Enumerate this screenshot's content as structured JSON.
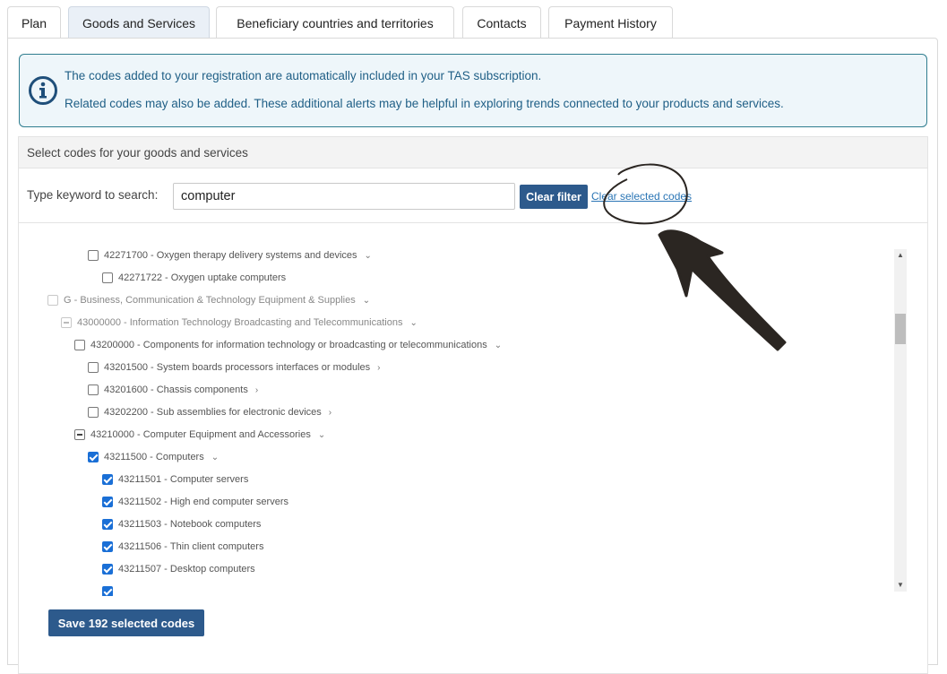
{
  "tabs": [
    {
      "label": "Plan"
    },
    {
      "label": "Goods and Services"
    },
    {
      "label": "Beneficiary countries and territories"
    },
    {
      "label": "Contacts"
    },
    {
      "label": "Payment History"
    }
  ],
  "info": {
    "line1": "The codes added to your registration are automatically included in your TAS subscription.",
    "line2": "Related codes may also be added. These additional alerts may be helpful in exploring trends connected to your products and services."
  },
  "codes": {
    "header": "Select codes for your goods and services",
    "search_label": "Type keyword to search:",
    "search_value": "computer",
    "clear_filter": "Clear filter",
    "clear_selected": "Clear selected codes",
    "save_label": "Save 192 selected codes"
  },
  "tree": [
    {
      "code": "42271700 -",
      "name": "Oxygen therapy delivery systems and devices",
      "state": "unchecked",
      "toggle": "expanded"
    },
    {
      "code": "42271722 -",
      "name": "Oxygen uptake computers",
      "state": "unchecked",
      "toggle": ""
    },
    {
      "code": "G -",
      "name": "Business, Communication & Technology Equipment & Supplies",
      "state": "disabled",
      "toggle": "expanded"
    },
    {
      "code": "43000000 -",
      "name": "Information Technology Broadcasting and Telecommunications",
      "state": "partial-disabled",
      "toggle": "expanded"
    },
    {
      "code": "43200000 -",
      "name": "Components for information technology or broadcasting or telecommunications",
      "state": "unchecked",
      "toggle": "expanded"
    },
    {
      "code": "43201500 -",
      "name": "System boards processors interfaces or modules",
      "state": "unchecked",
      "toggle": "collapsed"
    },
    {
      "code": "43201600 -",
      "name": "Chassis components",
      "state": "unchecked",
      "toggle": "collapsed"
    },
    {
      "code": "43202200 -",
      "name": "Sub assemblies for electronic devices",
      "state": "unchecked",
      "toggle": "collapsed"
    },
    {
      "code": "43210000 -",
      "name": "Computer Equipment and Accessories",
      "state": "partial",
      "toggle": "expanded"
    },
    {
      "code": "43211500 -",
      "name": "Computers",
      "state": "checked",
      "toggle": "expanded"
    },
    {
      "code": "43211501 -",
      "name": "Computer servers",
      "state": "checked",
      "toggle": ""
    },
    {
      "code": "43211502 -",
      "name": "High end computer servers",
      "state": "checked",
      "toggle": ""
    },
    {
      "code": "43211503 -",
      "name": "Notebook computers",
      "state": "checked",
      "toggle": ""
    },
    {
      "code": "43211506 -",
      "name": "Thin client computers",
      "state": "checked",
      "toggle": ""
    },
    {
      "code": "43211507 -",
      "name": "Desktop computers",
      "state": "checked",
      "toggle": ""
    }
  ],
  "colors": {
    "accent": "#2d5a8c",
    "info_border": "#2f7d8f",
    "info_text": "#1f5f86",
    "checkbox_checked": "#1a6fd6",
    "annotation": "#2b2622"
  },
  "icons": {
    "info": "info-circle-icon",
    "expand": "chevron-down-icon",
    "collapse": "chevron-right-icon"
  },
  "scrollbar": {
    "position": 0.2
  }
}
